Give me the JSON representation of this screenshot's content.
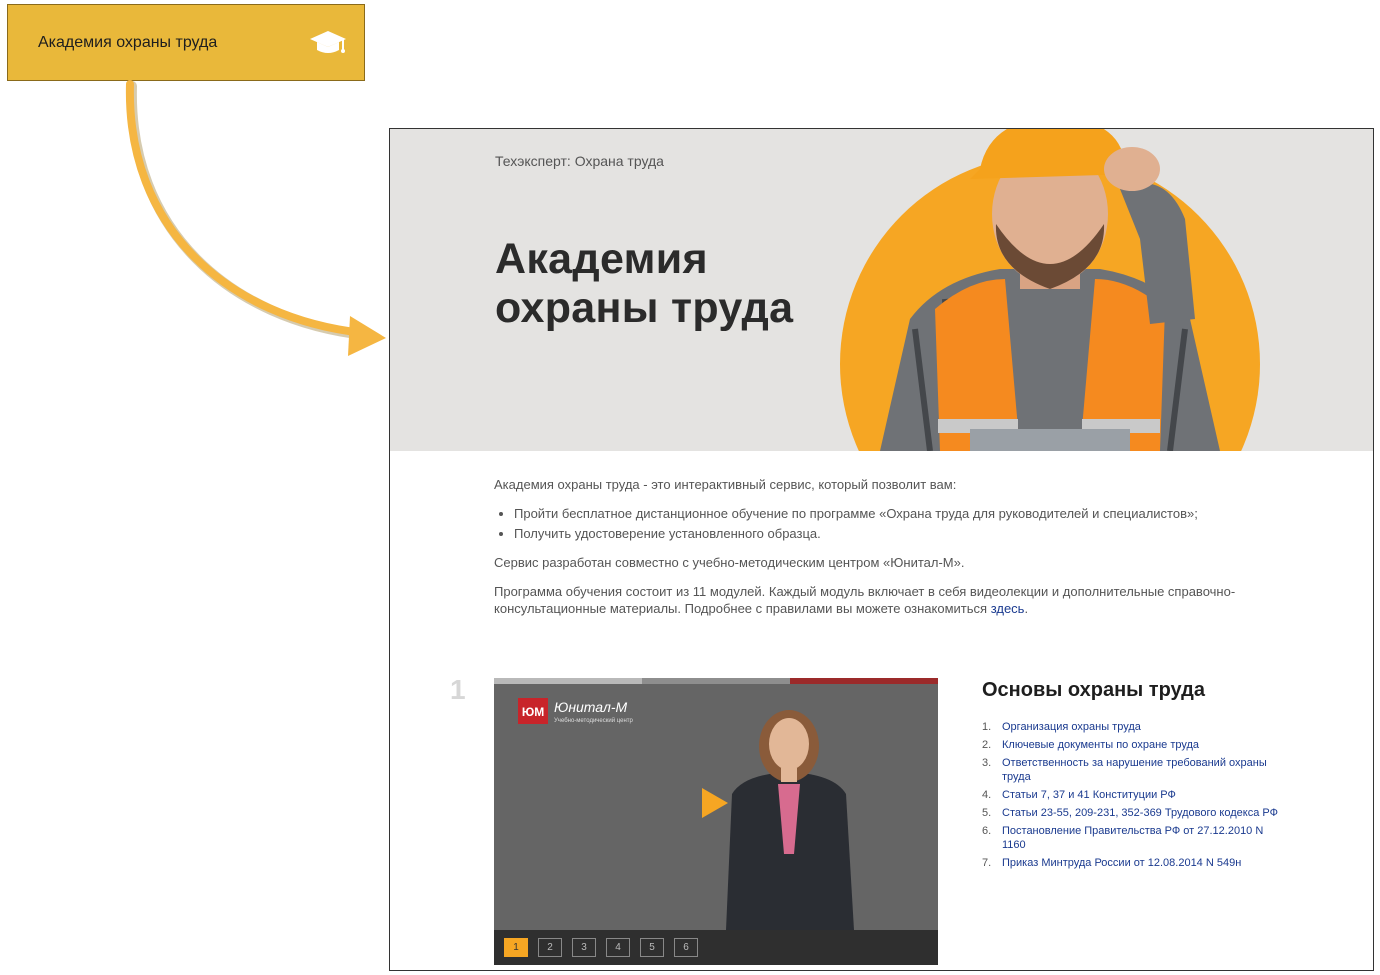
{
  "tile": {
    "label": "Академия охраны труда",
    "icon": "graduation-cap-icon"
  },
  "colors": {
    "tile": "#e9b83a",
    "accent": "#f6a623",
    "link": "#1a3a8f",
    "hero_bg": "#e4e3e1"
  },
  "hero": {
    "kicker": "Техэксперт: Охрана труда",
    "title_line1": "Академия",
    "title_line2": "охраны труда"
  },
  "intro": {
    "lead": "Академия охраны труда - это интерактивный сервис, который позволит вам:",
    "bullets": [
      "Пройти бесплатное дистанционное обучение по программе «Охрана труда для руководителей и специалистов»;",
      "Получить удостоверение установленного образца."
    ],
    "dev": "Сервис разработан совместно с учебно-методическим центром «Юнитал-М».",
    "program_text": "Программа обучения состоит из 11 модулей. Каждый модуль включает в себя видеолекции и дополнительные справочно-консультационные материалы. Подробнее с правилами вы можете ознакомиться ",
    "program_link": "здесь",
    "program_end": "."
  },
  "module": {
    "number": "1",
    "title": "Основы охраны труда",
    "video": {
      "logo_text": "Юнитал-М",
      "logo_sub": "Учебно-методический центр",
      "logo_mark": "ЮМ",
      "pages": [
        "1",
        "2",
        "3",
        "4",
        "5",
        "6"
      ],
      "active_page": "1"
    },
    "topics": [
      {
        "n": "1.",
        "text": "Организация охраны труда"
      },
      {
        "n": "2.",
        "text": "Ключевые документы по охране труда"
      },
      {
        "n": "3.",
        "text": "Ответственность за нарушение требований охраны труда"
      },
      {
        "n": "4.",
        "text": "Статьи 7, 37 и 41 Конституции РФ"
      },
      {
        "n": "5.",
        "text": "Статьи 23-55, 209-231, 352-369 Трудового кодекса РФ"
      },
      {
        "n": "6.",
        "text": "Постановление Правительства РФ от 27.12.2010 N 1160"
      },
      {
        "n": "7.",
        "text": "Приказ Минтруда России от 12.08.2014 N 549н"
      }
    ]
  }
}
